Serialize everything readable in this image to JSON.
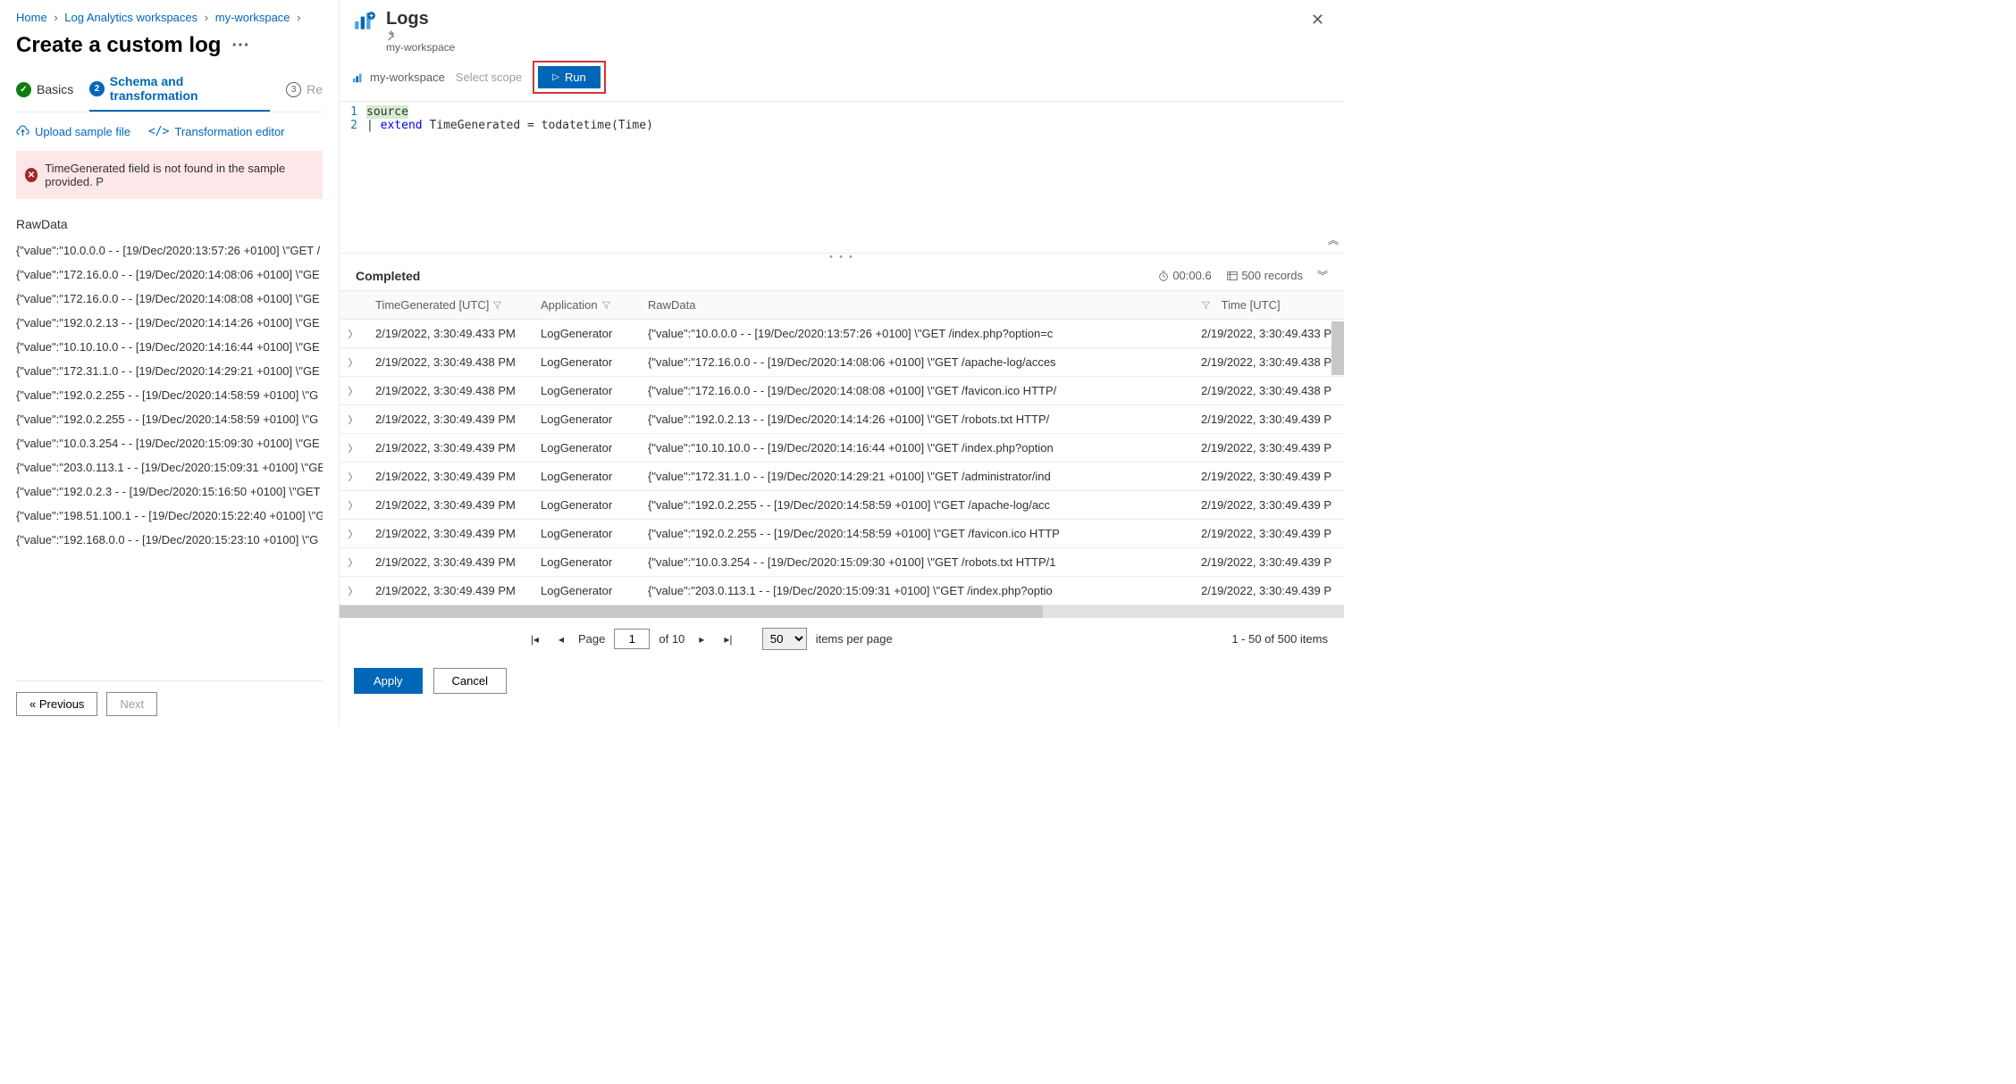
{
  "breadcrumbs": [
    "Home",
    "Log Analytics workspaces",
    "my-workspace"
  ],
  "page_title": "Create a custom log",
  "steps": {
    "s1": "Basics",
    "s2": "Schema and transformation",
    "s3_num": "3",
    "s3": "Re"
  },
  "toolbar": {
    "upload": "Upload sample file",
    "transform": "Transformation editor"
  },
  "alert_text": "TimeGenerated field is not found in the sample provided. P",
  "raw_header": "RawData",
  "raw_lines": [
    "{\"value\":\"10.0.0.0 - - [19/Dec/2020:13:57:26 +0100] \\\"GET /",
    "{\"value\":\"172.16.0.0 - - [19/Dec/2020:14:08:06 +0100] \\\"GE",
    "{\"value\":\"172.16.0.0 - - [19/Dec/2020:14:08:08 +0100] \\\"GE",
    "{\"value\":\"192.0.2.13  - - [19/Dec/2020:14:14:26 +0100] \\\"GE",
    "{\"value\":\"10.10.10.0 - - [19/Dec/2020:14:16:44 +0100] \\\"GE",
    "{\"value\":\"172.31.1.0 - - [19/Dec/2020:14:29:21 +0100] \\\"GE",
    "{\"value\":\"192.0.2.255 - - [19/Dec/2020:14:58:59 +0100] \\\"G",
    "{\"value\":\"192.0.2.255 - - [19/Dec/2020:14:58:59 +0100] \\\"G",
    "{\"value\":\"10.0.3.254 - - [19/Dec/2020:15:09:30 +0100] \\\"GE",
    "{\"value\":\"203.0.113.1 - - [19/Dec/2020:15:09:31 +0100] \\\"GE",
    "{\"value\":\"192.0.2.3  - - [19/Dec/2020:15:16:50 +0100] \\\"GET",
    "{\"value\":\"198.51.100.1 - - [19/Dec/2020:15:22:40 +0100] \\\"G",
    "{\"value\":\"192.168.0.0  - - [19/Dec/2020:15:23:10 +0100] \\\"G"
  ],
  "prev_btn": "« Previous",
  "next_btn": "Next",
  "logs": {
    "title": "Logs",
    "subtitle": "my-workspace",
    "scope": "my-workspace",
    "select_scope": "Select scope",
    "run": "Run"
  },
  "editor_lines": {
    "l1n": "1",
    "l1": "source",
    "l2n": "2",
    "l2_pipe": "|",
    "l2_kw": "extend",
    "l2_rest": " TimeGenerated = todatetime(Time)"
  },
  "results": {
    "status": "Completed",
    "duration": "00:00.6",
    "count": "500 records",
    "cols": {
      "time": "TimeGenerated [UTC]",
      "app": "Application",
      "raw": "RawData",
      "time2": "Time [UTC]"
    },
    "rows": [
      {
        "t": "2/19/2022, 3:30:49.433 PM",
        "a": "LogGenerator",
        "r": "{\"value\":\"10.0.0.0 - - [19/Dec/2020:13:57:26 +0100] \\\"GET /index.php?option=c",
        "t2": "2/19/2022, 3:30:49.433 P"
      },
      {
        "t": "2/19/2022, 3:30:49.438 PM",
        "a": "LogGenerator",
        "r": "{\"value\":\"172.16.0.0 - - [19/Dec/2020:14:08:06 +0100] \\\"GET /apache-log/acces",
        "t2": "2/19/2022, 3:30:49.438 P"
      },
      {
        "t": "2/19/2022, 3:30:49.438 PM",
        "a": "LogGenerator",
        "r": "{\"value\":\"172.16.0.0  - - [19/Dec/2020:14:08:08 +0100] \\\"GET /favicon.ico HTTP/",
        "t2": "2/19/2022, 3:30:49.438 P"
      },
      {
        "t": "2/19/2022, 3:30:49.439 PM",
        "a": "LogGenerator",
        "r": "{\"value\":\"192.0.2.13  - - [19/Dec/2020:14:14:26 +0100] \\\"GET /robots.txt HTTP/",
        "t2": "2/19/2022, 3:30:49.439 P"
      },
      {
        "t": "2/19/2022, 3:30:49.439 PM",
        "a": "LogGenerator",
        "r": "{\"value\":\"10.10.10.0 - - [19/Dec/2020:14:16:44 +0100] \\\"GET /index.php?option",
        "t2": "2/19/2022, 3:30:49.439 P"
      },
      {
        "t": "2/19/2022, 3:30:49.439 PM",
        "a": "LogGenerator",
        "r": "{\"value\":\"172.31.1.0 - - [19/Dec/2020:14:29:21 +0100] \\\"GET /administrator/ind",
        "t2": "2/19/2022, 3:30:49.439 P"
      },
      {
        "t": "2/19/2022, 3:30:49.439 PM",
        "a": "LogGenerator",
        "r": "{\"value\":\"192.0.2.255 - - [19/Dec/2020:14:58:59 +0100] \\\"GET /apache-log/acc",
        "t2": "2/19/2022, 3:30:49.439 P"
      },
      {
        "t": "2/19/2022, 3:30:49.439 PM",
        "a": "LogGenerator",
        "r": "{\"value\":\"192.0.2.255 - - [19/Dec/2020:14:58:59 +0100] \\\"GET /favicon.ico HTTP",
        "t2": "2/19/2022, 3:30:49.439 P"
      },
      {
        "t": "2/19/2022, 3:30:49.439 PM",
        "a": "LogGenerator",
        "r": "{\"value\":\"10.0.3.254 - - [19/Dec/2020:15:09:30 +0100] \\\"GET /robots.txt HTTP/1",
        "t2": "2/19/2022, 3:30:49.439 P"
      },
      {
        "t": "2/19/2022, 3:30:49.439 PM",
        "a": "LogGenerator",
        "r": "{\"value\":\"203.0.113.1 - - [19/Dec/2020:15:09:31 +0100] \\\"GET /index.php?optio",
        "t2": "2/19/2022, 3:30:49.439 P"
      }
    ]
  },
  "pager": {
    "page_label": "Page",
    "page_val": "1",
    "of_label": "of 10",
    "size": "50",
    "ipp": "items per page",
    "range": "1 - 50 of 500 items"
  },
  "apply_btn": "Apply",
  "cancel_btn": "Cancel"
}
